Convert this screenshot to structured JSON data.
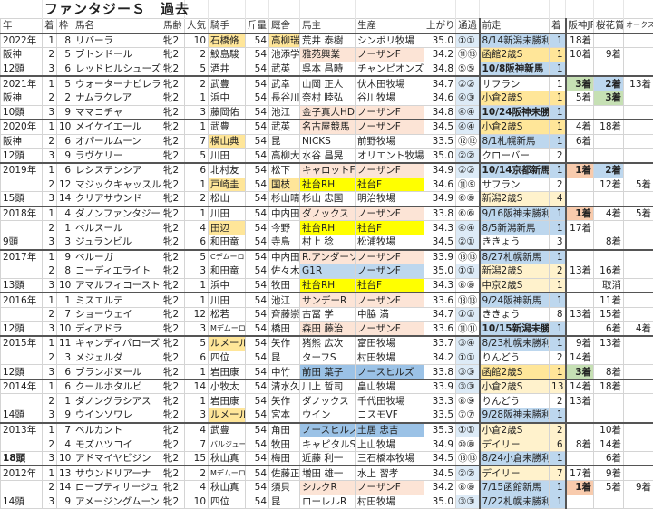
{
  "title": "ファンタジーＳ　過去",
  "headers": [
    "年",
    "着",
    "枠",
    "馬名",
    "馬齢",
    "人気",
    "騎手",
    "斤量",
    "厩舎",
    "馬主",
    "生産",
    "上がり",
    "通過",
    "前走",
    "着",
    "阪神JF",
    "桜花賞",
    "オークス"
  ],
  "colors": {
    "h": "#ffe699",
    "p": "#fce4d6",
    "y": "#ffff00",
    "b": "#bdd7ee",
    "B": "#9bc2e6",
    "ly": "#fff2cc",
    "g": "#c6e0b4",
    "s": "#f8cbad"
  },
  "rows": [
    {
      "c": [
        "2022年",
        "1",
        "8",
        "リバーラ",
        "牝2",
        "10",
        "石橋脩",
        "54",
        "高柳瑞",
        "荒井 泰樹",
        "シンボリ牧場",
        "35.0",
        "①①",
        "8/14新潟未勝利",
        "1",
        "18着",
        "",
        ""
      ],
      "s": {
        "6": "h",
        "8": "h",
        "13": "b",
        "14": "b"
      }
    },
    {
      "c": [
        "阪神",
        "2",
        "5",
        "ブトンドール",
        "牝2",
        "2",
        "鮫島駿",
        "54",
        "池添学",
        "雅苑興業",
        "ノーザンF",
        "34.2",
        "⑪⑬",
        "函館2歳S",
        "1",
        "10着",
        "9着",
        ""
      ],
      "s": {
        "9": "p",
        "10": "p",
        "13": "h",
        "14": "h"
      }
    },
    {
      "c": [
        "12頭",
        "3",
        "6",
        "レッドヒルシューズ",
        "牝2",
        "5",
        "酒井",
        "54",
        "武英",
        "呉本 昌時",
        "チャンピオンズF",
        "34.8",
        "⑤⑤",
        "10/8阪神新馬",
        "1",
        "",
        "",
        ""
      ],
      "s": {
        "13": "b bold",
        "14": "b"
      }
    },
    {
      "c": [
        "2021年",
        "1",
        "5",
        "ウォーターナビレラ",
        "牝2",
        "2",
        "武豊",
        "54",
        "武幸",
        "山岡 正人",
        "伏木田牧場",
        "34.7",
        "②②",
        "サフラン",
        "1",
        "3着",
        "2着",
        "13着"
      ],
      "s": {
        "15": "g bold",
        "16": "b bold"
      }
    },
    {
      "c": [
        "阪神",
        "2",
        "2",
        "ナムラクレア",
        "牝2",
        "1",
        "浜中",
        "54",
        "長谷川",
        "奈村 睦弘",
        "谷川牧場",
        "34.6",
        "④③",
        "小倉2歳S",
        "1",
        "5着",
        "3着",
        ""
      ],
      "s": {
        "13": "h",
        "14": "h",
        "16": "g bold"
      }
    },
    {
      "c": [
        "10頭",
        "3",
        "9",
        "ママコチャ",
        "牝2",
        "3",
        "藤岡佑",
        "54",
        "池江",
        "金子真人HD",
        "ノーザンF",
        "34.8",
        "④④",
        "10/24阪神未勝利",
        "1",
        "",
        "",
        ""
      ],
      "s": {
        "9": "p",
        "10": "p",
        "13": "b bold",
        "14": "b"
      }
    },
    {
      "c": [
        "2020年",
        "1",
        "10",
        "メイケイエール",
        "牝2",
        "1",
        "武豊",
        "54",
        "武英",
        "名古屋競馬",
        "ノーザンF",
        "34.5",
        "④④",
        "小倉2歳S",
        "1",
        "4着",
        "18着",
        ""
      ],
      "s": {
        "9": "p",
        "10": "p",
        "13": "h",
        "14": "h"
      }
    },
    {
      "c": [
        "阪神",
        "2",
        "6",
        "オパールムーン",
        "牝2",
        "7",
        "横山典",
        "54",
        "昆",
        "NICKS",
        "前野牧場",
        "33.5",
        "⑫⑫",
        "8/1札幌新馬",
        "1",
        "6着",
        "",
        ""
      ],
      "s": {
        "6": "h",
        "13": "b",
        "14": "b"
      }
    },
    {
      "c": [
        "12頭",
        "3",
        "9",
        "ラヴケリー",
        "牝2",
        "5",
        "川田",
        "54",
        "高柳大",
        "水谷 昌晃",
        "オリエント牧場",
        "35.0",
        "②②",
        "クローバー",
        "2",
        "",
        "",
        ""
      ],
      "s": {}
    },
    {
      "c": [
        "2019年",
        "1",
        "6",
        "レシステンシア",
        "牝2",
        "6",
        "北村友",
        "54",
        "松下",
        "キャロットF",
        "ノーザンF",
        "34.9",
        "②②",
        "10/14京都新馬",
        "1",
        "1着",
        "2着",
        ""
      ],
      "s": {
        "9": "p",
        "10": "p",
        "13": "b bold",
        "14": "b",
        "15": "s bold",
        "16": "b bold"
      }
    },
    {
      "c": [
        "",
        "2",
        "12",
        "マジックキャッスル",
        "牝2",
        "1",
        "戸崎圭",
        "54",
        "国枝",
        "社台RH",
        "社台F",
        "34.6",
        "⑪⑨",
        "サフラン",
        "2",
        "",
        "12着",
        "5着"
      ],
      "s": {
        "6": "h",
        "8": "h",
        "9": "y",
        "10": "y"
      }
    },
    {
      "c": [
        "15頭",
        "3",
        "14",
        "クリアサウンド",
        "牝2",
        "2",
        "松山",
        "54",
        "杉山晴",
        "杉山 忠国",
        "明治牧場",
        "34.9",
        "⑥⑧",
        "新潟2歳S",
        "4",
        "",
        "",
        ""
      ],
      "s": {
        "13": "ly",
        "14": "ly"
      }
    },
    {
      "c": [
        "2018年",
        "1",
        "4",
        "ダノンファンタジー",
        "牝2",
        "1",
        "川田",
        "54",
        "中内田",
        "ダノックス",
        "ノーザンF",
        "33.8",
        "⑥⑥",
        "9/16阪神未勝利",
        "1",
        "1着",
        "4着",
        "5着"
      ],
      "s": {
        "9": "p",
        "10": "p",
        "13": "b",
        "14": "b",
        "15": "s bold"
      }
    },
    {
      "c": [
        "",
        "2",
        "1",
        "ベルスール",
        "牝2",
        "4",
        "田辺",
        "54",
        "今野",
        "社台RH",
        "社台F",
        "34.3",
        "④④",
        "8/5新潟新馬",
        "1",
        "17着",
        "",
        ""
      ],
      "s": {
        "6": "h",
        "9": "y",
        "10": "y",
        "13": "b",
        "14": "b"
      }
    },
    {
      "c": [
        "9頭",
        "3",
        "3",
        "ジュランビル",
        "牝2",
        "6",
        "和田竜",
        "54",
        "寺島",
        "村上 稔",
        "松浦牧場",
        "34.5",
        "②①",
        "ききょう",
        "3",
        "",
        "8着",
        ""
      ],
      "s": {}
    },
    {
      "c": [
        "2017年",
        "1",
        "9",
        "ベルーガ",
        "牝2",
        "5",
        "Cデムーロ",
        "54",
        "中内田",
        "R.アンダーソン",
        "ノーザンF",
        "33.9",
        "⑬⑬",
        "8/27札幌新馬",
        "1",
        "",
        "",
        ""
      ],
      "s": {
        "6": "sm",
        "9": "p",
        "10": "p",
        "13": "b",
        "14": "b"
      }
    },
    {
      "c": [
        "",
        "2",
        "8",
        "コーディエライト",
        "牝2",
        "3",
        "和田竜",
        "54",
        "佐々木",
        "G1R",
        "ノーザンF",
        "35.0",
        "①①",
        "新潟2歳S",
        "2",
        "13着",
        "16着",
        ""
      ],
      "s": {
        "9": "b",
        "10": "b",
        "13": "ly",
        "14": "ly"
      }
    },
    {
      "c": [
        "13頭",
        "3",
        "10",
        "アマルフィコースト",
        "牝2",
        "1",
        "浜中",
        "54",
        "牧田",
        "社台RH",
        "社台F",
        "34.3",
        "⑧⑧",
        "中京2歳S",
        "1",
        "",
        "取消",
        ""
      ],
      "s": {
        "9": "y",
        "10": "y",
        "13": "ly",
        "14": "ly"
      }
    },
    {
      "c": [
        "2016年",
        "1",
        "1",
        "ミスエルテ",
        "牝2",
        "1",
        "川田",
        "54",
        "池江",
        "サンデーR",
        "ノーザンF",
        "33.6",
        "⑬⑬",
        "9/24阪神新馬",
        "1",
        "",
        "11着",
        ""
      ],
      "s": {
        "9": "p",
        "10": "p",
        "13": "b",
        "14": "b"
      }
    },
    {
      "c": [
        "",
        "2",
        "7",
        "ショーウェイ",
        "牝2",
        "12",
        "松若",
        "54",
        "斉藤崇",
        "古冨 学",
        "中脇 満",
        "34.7",
        "①①",
        "ききょう",
        "8",
        "13着",
        "15着",
        ""
      ],
      "s": {}
    },
    {
      "c": [
        "12頭",
        "3",
        "10",
        "ディアドラ",
        "牝2",
        "3",
        "Mデムーロ",
        "54",
        "橋田",
        "森田 藤治",
        "ノーザンF",
        "33.6",
        "⑪⑪",
        "10/15新潟未勝利",
        "1",
        "",
        "6着",
        "4着"
      ],
      "s": {
        "6": "sm",
        "9": "p",
        "10": "p",
        "13": "b bold",
        "14": "b"
      }
    },
    {
      "c": [
        "2015年",
        "1",
        "11",
        "キャンディバローズ",
        "牝2",
        "5",
        "ルメール",
        "54",
        "矢作",
        "猪熊 広次",
        "富田牧場",
        "33.7",
        "③④",
        "8/23札幌未勝利",
        "1",
        "9着",
        "13着",
        ""
      ],
      "s": {
        "6": "h",
        "13": "b",
        "14": "b"
      }
    },
    {
      "c": [
        "",
        "2",
        "3",
        "メジェルダ",
        "牝2",
        "6",
        "四位",
        "54",
        "昆",
        "ターフS",
        "村田牧場",
        "34.2",
        "①①",
        "りんどう",
        "2",
        "14着",
        "",
        ""
      ],
      "s": {}
    },
    {
      "c": [
        "12頭",
        "3",
        "6",
        "ブランボヌール",
        "牝2",
        "1",
        "岩田康",
        "54",
        "中竹",
        "前田 葉子",
        "ノースヒルズ",
        "33.8",
        "③③",
        "函館2歳S",
        "1",
        "3着",
        "8着",
        ""
      ],
      "s": {
        "9": "B",
        "10": "B",
        "13": "h",
        "14": "h",
        "15": "g bold"
      }
    },
    {
      "c": [
        "2014年",
        "1",
        "6",
        "クールホタルビ",
        "牝2",
        "14",
        "小牧太",
        "54",
        "清水久",
        "川上 哲司",
        "畠山牧場",
        "33.9",
        "③③",
        "小倉2歳S",
        "13",
        "14着",
        "18着",
        ""
      ],
      "s": {
        "13": "ly",
        "14": "ly"
      }
    },
    {
      "c": [
        "",
        "2",
        "1",
        "ダノングラシアス",
        "牝2",
        "1",
        "岩田康",
        "54",
        "矢作",
        "ダノックス",
        "千代田牧場",
        "33.3",
        "⑧⑨",
        "りんどう",
        "2",
        "13着",
        "",
        ""
      ],
      "s": {}
    },
    {
      "c": [
        "14頭",
        "3",
        "9",
        "ウインソワレ",
        "牝2",
        "3",
        "ルメール",
        "54",
        "宮本",
        "ウイン",
        "コスモVF",
        "33.5",
        "⑦⑦",
        "9/28阪神未勝利",
        "1",
        "",
        "",
        ""
      ],
      "s": {
        "6": "h",
        "13": "b",
        "14": "b"
      }
    },
    {
      "c": [
        "2013年",
        "1",
        "7",
        "ベルカント",
        "牝2",
        "4",
        "武豊",
        "54",
        "角田",
        "ノースヒルズ",
        "土居 忠吉",
        "35.3",
        "①①",
        "小倉2歳S",
        "2",
        "",
        "10着",
        ""
      ],
      "s": {
        "9": "B",
        "10": "B",
        "13": "ly",
        "14": "ly"
      }
    },
    {
      "c": [
        "",
        "2",
        "4",
        "モズハツコイ",
        "牝2",
        "7",
        "バルジュー",
        "54",
        "牧田",
        "キャピタルS",
        "上山牧場",
        "34.9",
        "⑩⑧",
        "デイリー",
        "6",
        "8着",
        "14着",
        ""
      ],
      "s": {
        "6": "sm",
        "13": "ly",
        "14": "ly"
      }
    },
    {
      "c": [
        "18頭",
        "3",
        "10",
        "アドマイヤビジン",
        "牝2",
        "15",
        "秋山真",
        "54",
        "梅田",
        "近藤 利一",
        "三石橋本牧場",
        "34.5",
        "⑬⑬",
        "8/24小倉未勝利",
        "1",
        "",
        "6着",
        ""
      ],
      "s": {
        "0": "bold",
        "13": "b",
        "14": "b"
      }
    },
    {
      "c": [
        "2012年",
        "1",
        "13",
        "サウンドリアーナ",
        "牝2",
        "2",
        "Mデムーロ",
        "54",
        "佐藤正",
        "増田 雄一",
        "水上 習孝",
        "34.5",
        "②②",
        "デイリー",
        "7",
        "17着",
        "9着",
        ""
      ],
      "s": {
        "6": "sm",
        "13": "ly",
        "14": "ly"
      }
    },
    {
      "c": [
        "",
        "2",
        "14",
        "ロープティサージュ",
        "牝2",
        "4",
        "秋山真",
        "54",
        "須貝",
        "シルクR",
        "ノーザンF",
        "34.2",
        "⑧⑧",
        "7/15函館新馬",
        "1",
        "1着",
        "5着",
        "9着"
      ],
      "s": {
        "9": "p",
        "10": "p",
        "13": "b",
        "14": "b",
        "15": "s bold"
      }
    },
    {
      "c": [
        "14頭",
        "3",
        "9",
        "アメージングムーン",
        "牝2",
        "10",
        "四位",
        "54",
        "昆",
        "ローレルR",
        "村田牧場",
        "35.0",
        "③③",
        "7/22札幌未勝利",
        "1",
        "",
        "",
        ""
      ],
      "s": {
        "13": "b",
        "14": "b"
      }
    }
  ]
}
